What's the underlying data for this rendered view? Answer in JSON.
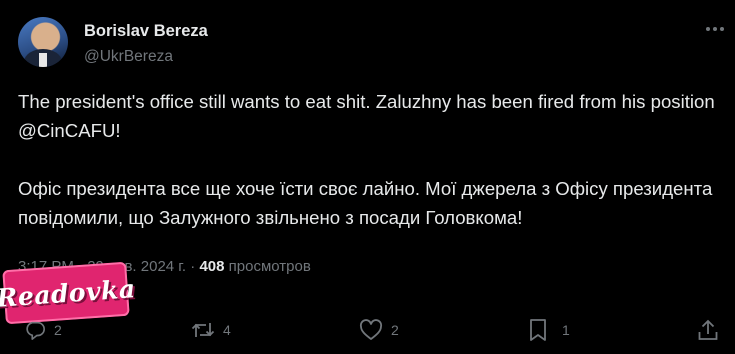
{
  "post": {
    "author_name": "Borislav Bereza",
    "author_handle": "@UkrBereza",
    "paragraphs": [
      "The president's office still wants to eat shit.  Zaluzhny has been fired from his position @CinCAFU!",
      "Офіс президента все ще хоче їсти своє лайно. Мої джерела з Офісу президента повідомили, що Залужного звільнено з посади Головкома!"
    ],
    "timestamp": "3:17 PM · 29 янв. 2024 г.",
    "views_count": "408",
    "views_label": "просмотров"
  },
  "watermark": {
    "text": "Readovka"
  },
  "actions": {
    "replies": "2",
    "reposts": "4",
    "likes": "2",
    "bookmarks": "1"
  },
  "icons": {
    "more": "more-dots-icon",
    "reply": "reply-bubble-icon",
    "repost": "repost-arrows-icon",
    "like": "heart-icon",
    "bookmark": "bookmark-icon",
    "share": "share-upload-icon"
  },
  "colors": {
    "background": "#000000",
    "text": "#e7e9ea",
    "secondary": "#71767b",
    "watermark_bg": "#e0256f"
  }
}
